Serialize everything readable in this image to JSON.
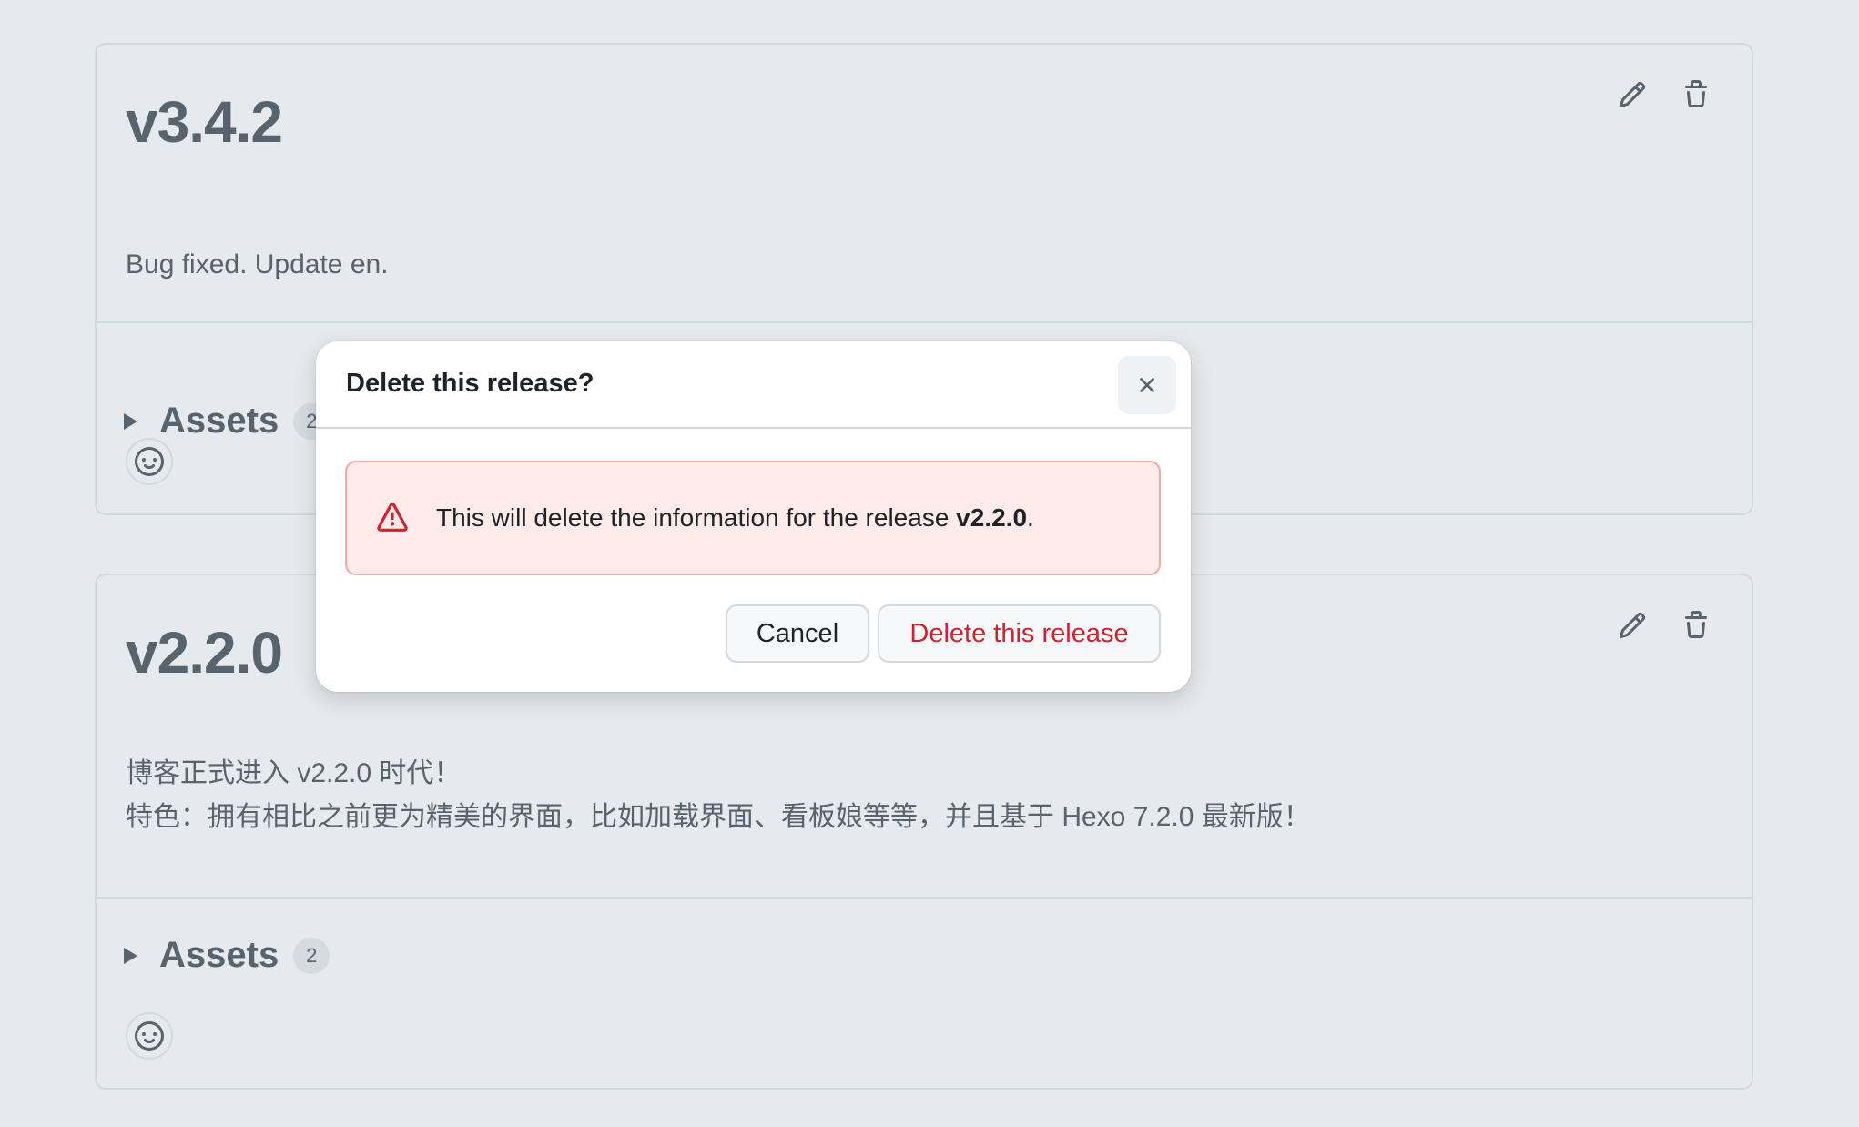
{
  "releases": [
    {
      "tag": "v3.4.2",
      "body": [
        "Bug fixed. Update en."
      ],
      "assets_label": "Assets",
      "assets_count": "2"
    },
    {
      "tag": "v2.2.0",
      "body": [
        "博客正式进入 v2.2.0 时代！",
        "特色：拥有相比之前更为精美的界面，比如加载界面、看板娘等等，并且基于 Hexo 7.2.0 最新版！"
      ],
      "assets_label": "Assets",
      "assets_count": "2"
    }
  ],
  "dialog": {
    "title": "Delete this release?",
    "message_prefix": "This will delete the information for the release ",
    "message_release": "v2.2.0",
    "message_suffix": ".",
    "cancel_label": "Cancel",
    "confirm_label": "Delete this release"
  },
  "colors": {
    "danger": "#cf222e",
    "flash_bg": "#ffebe9",
    "page_bg": "#e6e9ed"
  }
}
